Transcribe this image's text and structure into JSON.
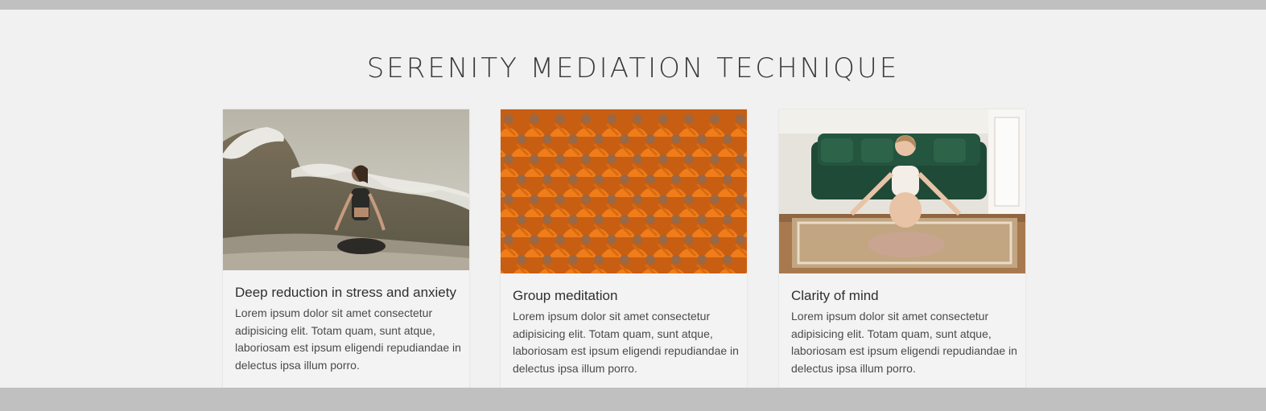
{
  "section": {
    "title": "SERENITY MEDIATION TECHNIQUE"
  },
  "cards": [
    {
      "image_icon": "mountain-yoga-photo",
      "title": "Deep reduction in stress and anxiety",
      "text": "Lorem ipsum dolor sit amet consectetur adipisicing elit. Totam quam, sunt atque, laboriosam est ipsum eligendi repudiandae in delectus ipsa illum porro."
    },
    {
      "image_icon": "monks-meditating-photo",
      "title": "Group meditation",
      "text": "Lorem ipsum dolor sit amet consectetur adipisicing elit. Totam quam, sunt atque, laboriosam est ipsum eligendi repudiandae in delectus ipsa illum porro."
    },
    {
      "image_icon": "woman-meditating-living-room-photo",
      "title": "Clarity of mind",
      "text": "Lorem ipsum dolor sit amet consectetur adipisicing elit. Totam quam, sunt atque, laboriosam est ipsum eligendi repudiandae in delectus ipsa illum porro."
    }
  ],
  "colors": {
    "page_background": "#f1f1f1",
    "outer_background": "#c0c0c0",
    "card_background": "#f3f3f3",
    "monk_robe": "#f07d1a",
    "sofa": "#1e4a37"
  }
}
